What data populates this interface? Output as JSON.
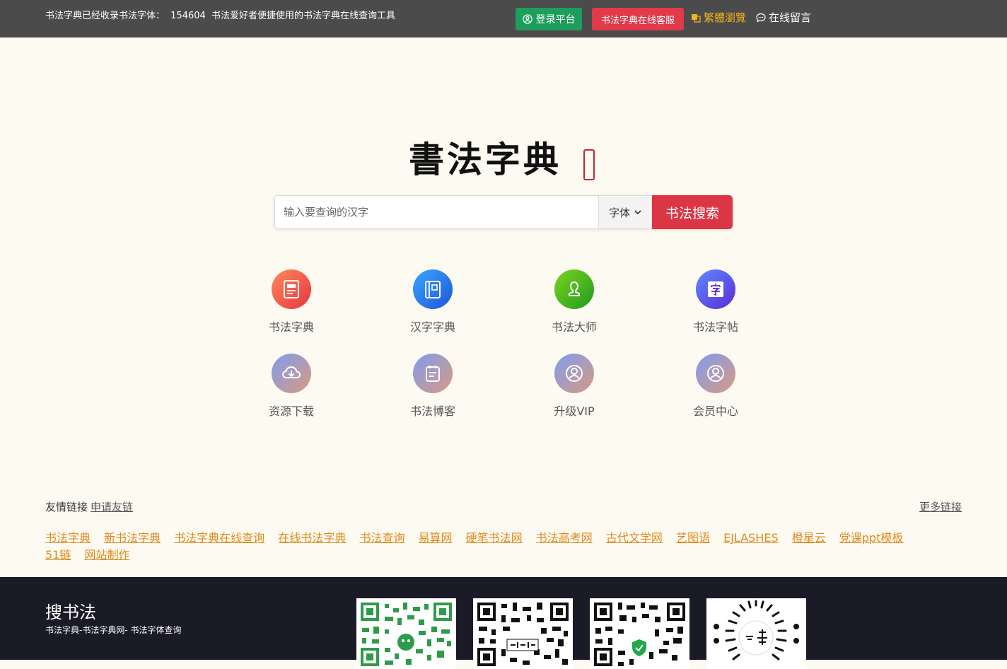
{
  "topbar": {
    "stats_prefix": "书法字典已经收录书法字体：",
    "stats_count": "154604",
    "stats_suffix": "书法爱好者便捷使用的书法字典在线查询工具",
    "login_label": "登录平台",
    "service_label": "书法字典在线客服",
    "traditional_label": "繁體瀏覽",
    "message_label": "在线留言"
  },
  "logo": {
    "title": "書法字典"
  },
  "search": {
    "placeholder": "输入要查询的汉字",
    "select_value": "字体",
    "button_label": "书法搜索"
  },
  "tiles": [
    {
      "label": "书法字典",
      "icon": "document-icon",
      "color": "#e8343e"
    },
    {
      "label": "汉字字典",
      "icon": "book-icon",
      "color": "#1f56d8"
    },
    {
      "label": "书法大师",
      "icon": "person-icon",
      "color": "#1e9b1e"
    },
    {
      "label": "书法字帖",
      "icon": "character-icon",
      "color": "#5a2bd6"
    },
    {
      "label": "资源下载",
      "icon": "cloud-download-icon",
      "color": "#9a8fd8"
    },
    {
      "label": "书法博客",
      "icon": "notepad-icon",
      "color": "#9a8fd8"
    },
    {
      "label": "升级VIP",
      "icon": "user-circle-icon",
      "color": "#9a8fd8"
    },
    {
      "label": "会员中心",
      "icon": "user-circle-icon",
      "color": "#9a8fd8"
    }
  ],
  "friend_links": {
    "title": "友情链接",
    "apply_label": "申请友链",
    "more_label": "更多链接",
    "links": [
      "书法字典",
      "新书法字典",
      "书法字典在线查询",
      "在线书法字典",
      "书法查询",
      "易算网",
      "硬笔书法网",
      "书法高考网",
      "古代文学网",
      "艺图语",
      "EJLASHES",
      "橙星云",
      "党课ppt模板",
      "51链",
      "网站制作"
    ]
  },
  "footer": {
    "brand": "搜书法",
    "subtitle": "书法字典-书法字典网- 书法字体查询"
  }
}
